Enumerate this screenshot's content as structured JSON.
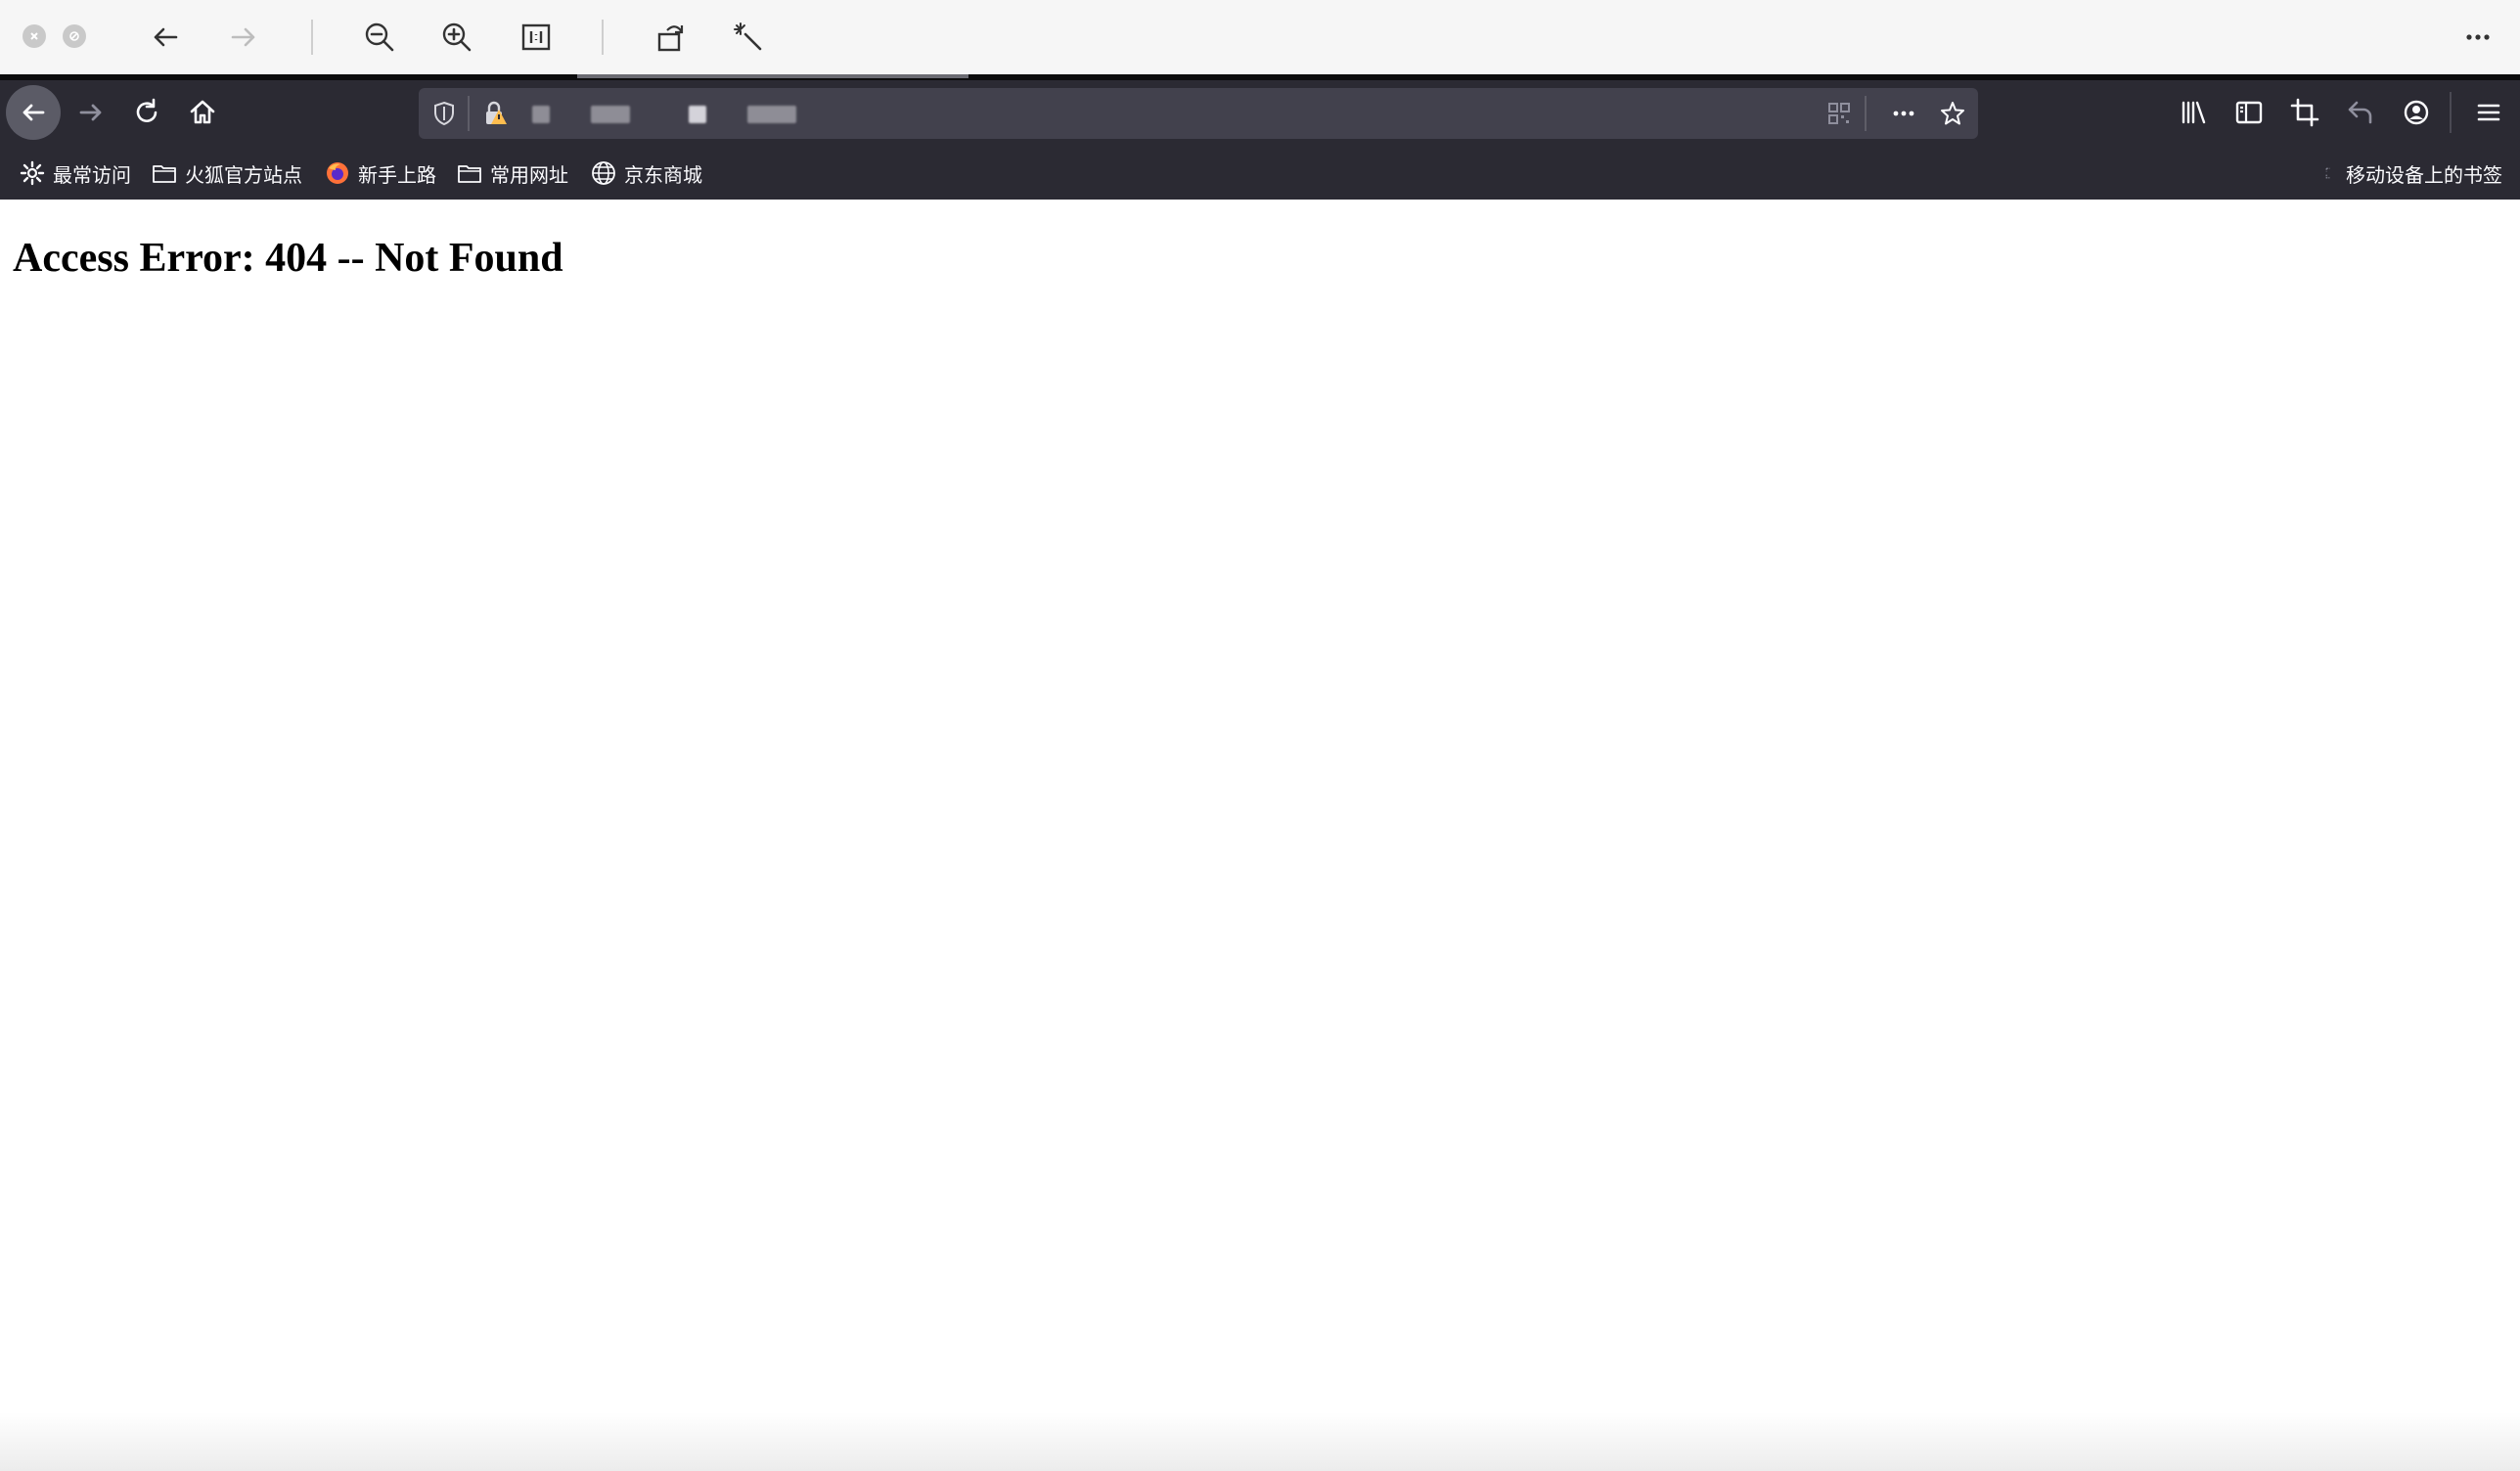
{
  "viewer_toolbar": {
    "close_icon": "close-circle-icon",
    "minimize_icon": "minimize-circle-icon",
    "back_icon": "arrow-left-icon",
    "forward_icon": "arrow-right-icon",
    "zoom_out_icon": "zoom-out-icon",
    "zoom_in_icon": "zoom-in-icon",
    "actual_size_icon": "actual-size-icon",
    "rotate_icon": "rotate-icon",
    "enhance_icon": "magic-wand-icon",
    "more_icon": "more-horizontal-icon"
  },
  "browser": {
    "nav": {
      "back_icon": "back-icon",
      "forward_icon": "forward-icon",
      "reload_icon": "reload-icon",
      "home_icon": "home-icon"
    },
    "urlbar": {
      "tracking_icon": "shield-icon",
      "lock_icon": "insecure-lock-icon",
      "qr_icon": "qr-code-icon",
      "page_actions_icon": "more-horizontal-icon",
      "bookmark_icon": "star-icon"
    },
    "toolbar_right": {
      "library_icon": "library-icon",
      "sidebar_icon": "sidebar-icon",
      "screenshot_icon": "crop-icon",
      "undo_icon": "undo-icon",
      "account_icon": "account-icon",
      "menu_icon": "hamburger-menu-icon"
    },
    "bookmarks": [
      {
        "label": "最常访问",
        "icon": "gear-icon"
      },
      {
        "label": "火狐官方站点",
        "icon": "folder-icon"
      },
      {
        "label": "新手上路",
        "icon": "firefox-icon"
      },
      {
        "label": "常用网址",
        "icon": "folder-icon"
      },
      {
        "label": "京东商城",
        "icon": "globe-icon"
      }
    ],
    "mobile_bookmarks": {
      "label": "移动设备上的书签",
      "icon": "folder-icon"
    }
  },
  "page": {
    "heading": "Access Error: 404 -- Not Found"
  },
  "colors": {
    "chrome_dark": "#2b2a33",
    "urlbar": "#42414d",
    "viewer_bg": "#f6f6f6",
    "page_bg": "#ffffff"
  }
}
